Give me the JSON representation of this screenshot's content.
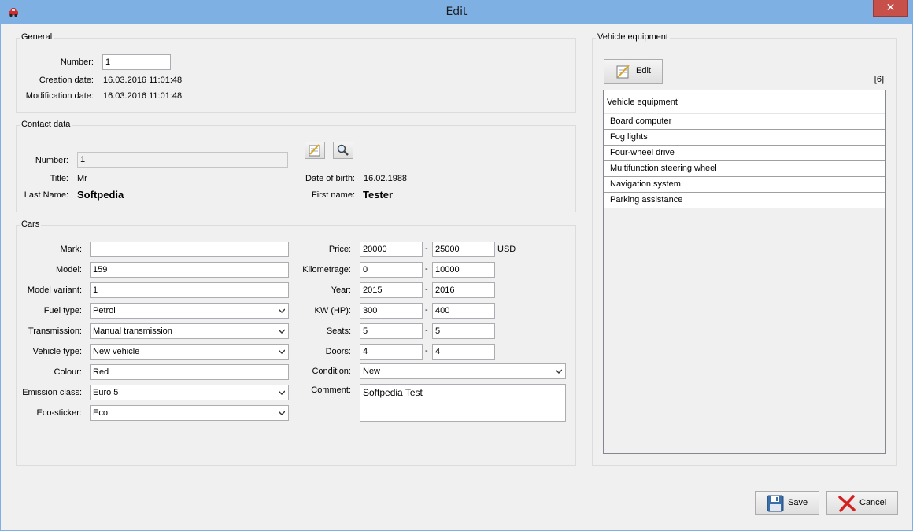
{
  "window": {
    "title": "Edit",
    "close_glyph": "✕"
  },
  "general": {
    "title": "General",
    "number_label": "Number:",
    "number_value": "1",
    "creation_label": "Creation date:",
    "creation_value": "16.03.2016  11:01:48",
    "modification_label": "Modification date:",
    "modification_value": "16.03.2016  11:01:48"
  },
  "contact": {
    "title": "Contact data",
    "number_label": "Number:",
    "number_value": "1",
    "title_label": "Title:",
    "title_value": "Mr",
    "dob_label": "Date of birth:",
    "dob_value": "16.02.1988",
    "lastname_label": "Last Name:",
    "lastname_value": "Softpedia",
    "firstname_label": "First name:",
    "firstname_value": "Tester"
  },
  "cars": {
    "title": "Cars",
    "left": [
      {
        "label": "Mark:",
        "value": "",
        "select": false
      },
      {
        "label": "Model:",
        "value": "159",
        "select": false
      },
      {
        "label": "Model variant:",
        "value": "1",
        "select": false
      },
      {
        "label": "Fuel type:",
        "value": "Petrol",
        "select": true
      },
      {
        "label": "Transmission:",
        "value": "Manual transmission",
        "select": true
      },
      {
        "label": "Vehicle type:",
        "value": "New vehicle",
        "select": true
      },
      {
        "label": "Colour:",
        "value": "Red",
        "select": false
      },
      {
        "label": "Emission class:",
        "value": "Euro 5",
        "select": true
      },
      {
        "label": "Eco-sticker:",
        "value": "Eco",
        "select": true
      }
    ],
    "ranges": [
      {
        "label": "Price:",
        "from": "20000",
        "to": "25000",
        "unit": "USD"
      },
      {
        "label": "Kilometrage:",
        "from": "0",
        "to": "10000",
        "unit": ""
      },
      {
        "label": "Year:",
        "from": "2015",
        "to": "2016",
        "unit": ""
      },
      {
        "label": "KW (HP):",
        "from": "300",
        "to": "400",
        "unit": ""
      },
      {
        "label": "Seats:",
        "from": "5",
        "to": "5",
        "unit": ""
      },
      {
        "label": "Doors:",
        "from": "4",
        "to": "4",
        "unit": ""
      }
    ],
    "dash": "-",
    "condition_label": "Condition:",
    "condition_value": "New",
    "comment_label": "Comment:",
    "comment_value": "Softpedia Test"
  },
  "equipment": {
    "title": "Vehicle equipment",
    "edit_label": "Edit",
    "count": "[6]",
    "column_header": "Vehicle equipment",
    "items": [
      "Board computer",
      "Fog lights",
      "Four-wheel drive",
      "Multifunction steering wheel",
      "Navigation system",
      "Parking assistance"
    ]
  },
  "footer": {
    "save_label": "Save",
    "cancel_label": "Cancel"
  },
  "icons": {
    "app": "car-icon",
    "edit": "edit-notepad-icon",
    "search": "magnifier-icon",
    "save": "floppy-disk-icon",
    "cancel": "red-x-icon",
    "chevron": "chevron-down-icon"
  }
}
